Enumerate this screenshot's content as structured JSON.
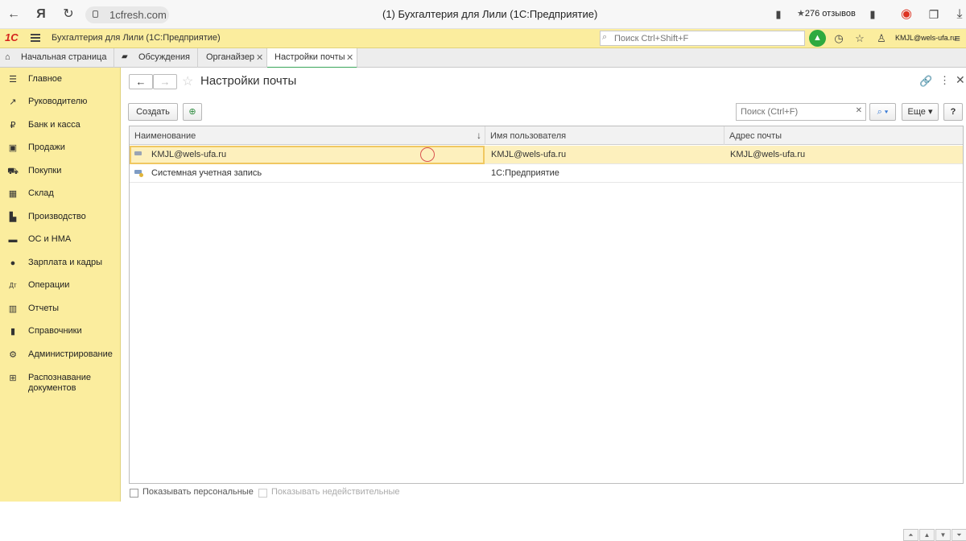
{
  "browser": {
    "url": "1cfresh.com",
    "tab_title": "(1) Бухгалтерия для Лили (1С:Предприятие)",
    "reviews": "276 отзывов"
  },
  "app_header": {
    "title": "Бухгалтерия для Лили  (1С:Предприятие)",
    "search_placeholder": "Поиск Ctrl+Shift+F",
    "user": "KMJL@wels-ufa.ru"
  },
  "tabs": [
    {
      "label": "Начальная страница"
    },
    {
      "label": "Обсуждения"
    },
    {
      "label": "Органайзер"
    },
    {
      "label": "Настройки почты"
    }
  ],
  "sidebar": {
    "items": [
      {
        "label": "Главное",
        "icon": "menu-icon"
      },
      {
        "label": "Руководителю",
        "icon": "trend-icon"
      },
      {
        "label": "Банк и касса",
        "icon": "ruble-icon"
      },
      {
        "label": "Продажи",
        "icon": "bag-icon"
      },
      {
        "label": "Покупки",
        "icon": "cart-icon"
      },
      {
        "label": "Склад",
        "icon": "warehouse-icon"
      },
      {
        "label": "Производство",
        "icon": "factory-icon"
      },
      {
        "label": "ОС и НМА",
        "icon": "truck-icon"
      },
      {
        "label": "Зарплата и кадры",
        "icon": "person-icon"
      },
      {
        "label": "Операции",
        "icon": "operations-icon"
      },
      {
        "label": "Отчеты",
        "icon": "chart-icon"
      },
      {
        "label": "Справочники",
        "icon": "books-icon"
      },
      {
        "label": "Администрирование",
        "icon": "gear-icon"
      },
      {
        "label": "Распознавание документов",
        "icon": "scan-icon"
      }
    ]
  },
  "page": {
    "title": "Настройки почты",
    "create_label": "Создать",
    "search_placeholder": "Поиск (Ctrl+F)",
    "more_label": "Еще",
    "help_label": "?"
  },
  "table": {
    "columns": [
      "Наименование",
      "Имя пользователя",
      "Адрес почты"
    ],
    "rows": [
      {
        "name": "KMJL@wels-ufa.ru",
        "user": "KMJL@wels-ufa.ru",
        "address": "KMJL@wels-ufa.ru"
      },
      {
        "name": "Системная учетная запись",
        "user": "1С:Предприятие",
        "address": ""
      }
    ]
  },
  "footer": {
    "show_personal": "Показывать персональные",
    "show_invalid": "Показывать недействительные"
  },
  "colors": {
    "sidebar_bg": "#fbed9e",
    "selected_row": "#fdf0bd",
    "accent_green": "#2eaa3f"
  }
}
